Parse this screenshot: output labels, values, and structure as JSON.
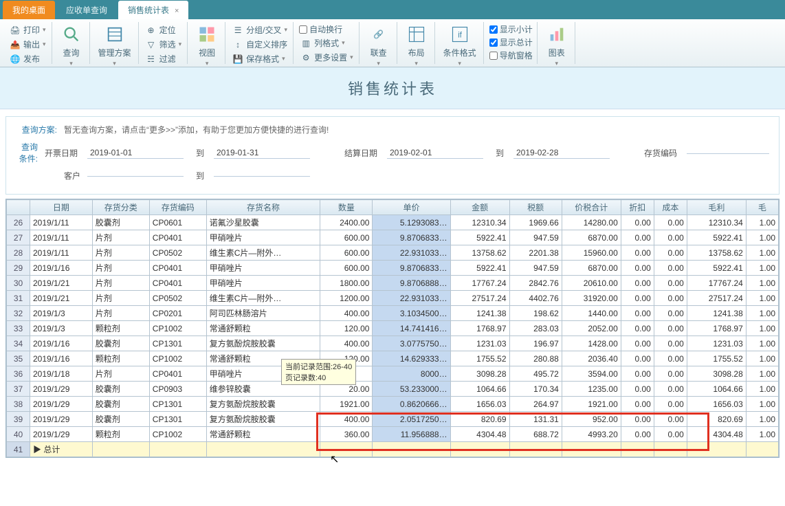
{
  "tabs": {
    "desktop": "我的桌面",
    "receivable": "应收单查询",
    "sales": "销售统计表"
  },
  "ribbon": {
    "print": "打印",
    "export": "输出",
    "publish": "发布",
    "search": "查询",
    "scheme": "管理方案",
    "locate": "定位",
    "filter": "筛选",
    "filter2": "过滤",
    "view": "视图",
    "group": "分组/交叉",
    "sort": "自定义排序",
    "savefmt": "保存格式",
    "autowrap": "自动换行",
    "colfmt": "列格式",
    "more": "更多设置",
    "link": "联查",
    "layout": "布局",
    "condfmt": "条件格式",
    "subtotal": "显示小计",
    "total": "显示总计",
    "nav": "导航窗格",
    "chart": "图表"
  },
  "title": "销售统计表",
  "query": {
    "scheme_label": "查询方案:",
    "scheme_text": "暂无查询方案，请点击“更多>>”添加，有助于您更加方便快捷的进行查询!",
    "cond_label": "查询条件:",
    "invoice_date": "开票日期",
    "to": "到",
    "settle_date": "结算日期",
    "inv_code": "存货编码",
    "customer": "客户",
    "d1": "2019-01-01",
    "d2": "2019-01-31",
    "d3": "2019-02-01",
    "d4": "2019-02-28"
  },
  "cols": {
    "date": "日期",
    "cat": "存货分类",
    "code": "存货编码",
    "name": "存货名称",
    "qty": "数量",
    "price": "单价",
    "amount": "金额",
    "tax": "税额",
    "pricetax": "价税合计",
    "discount": "折扣",
    "cost": "成本",
    "profit": "毛利",
    "rate": "毛"
  },
  "rows": [
    {
      "n": "26",
      "date": "2019/1/11",
      "cat": "胶囊剂",
      "code": "CP0601",
      "name": "诺氟沙星胶囊",
      "qty": "2400.00",
      "price": "5.1293083…",
      "amount": "12310.34",
      "tax": "1969.66",
      "pt": "14280.00",
      "disc": "0.00",
      "cost": "0.00",
      "profit": "12310.34",
      "r": "1.00"
    },
    {
      "n": "27",
      "date": "2019/1/11",
      "cat": "片剂",
      "code": "CP0401",
      "name": "甲硝唑片",
      "qty": "600.00",
      "price": "9.8706833…",
      "amount": "5922.41",
      "tax": "947.59",
      "pt": "6870.00",
      "disc": "0.00",
      "cost": "0.00",
      "profit": "5922.41",
      "r": "1.00"
    },
    {
      "n": "28",
      "date": "2019/1/11",
      "cat": "片剂",
      "code": "CP0502",
      "name": "维生素C片—附外…",
      "qty": "600.00",
      "price": "22.931033…",
      "amount": "13758.62",
      "tax": "2201.38",
      "pt": "15960.00",
      "disc": "0.00",
      "cost": "0.00",
      "profit": "13758.62",
      "r": "1.00"
    },
    {
      "n": "29",
      "date": "2019/1/16",
      "cat": "片剂",
      "code": "CP0401",
      "name": "甲硝唑片",
      "qty": "600.00",
      "price": "9.8706833…",
      "amount": "5922.41",
      "tax": "947.59",
      "pt": "6870.00",
      "disc": "0.00",
      "cost": "0.00",
      "profit": "5922.41",
      "r": "1.00"
    },
    {
      "n": "30",
      "date": "2019/1/21",
      "cat": "片剂",
      "code": "CP0401",
      "name": "甲硝唑片",
      "qty": "1800.00",
      "price": "9.8706888…",
      "amount": "17767.24",
      "tax": "2842.76",
      "pt": "20610.00",
      "disc": "0.00",
      "cost": "0.00",
      "profit": "17767.24",
      "r": "1.00"
    },
    {
      "n": "31",
      "date": "2019/1/21",
      "cat": "片剂",
      "code": "CP0502",
      "name": "维生素C片—附外…",
      "qty": "1200.00",
      "price": "22.931033…",
      "amount": "27517.24",
      "tax": "4402.76",
      "pt": "31920.00",
      "disc": "0.00",
      "cost": "0.00",
      "profit": "27517.24",
      "r": "1.00"
    },
    {
      "n": "32",
      "date": "2019/1/3",
      "cat": "片剂",
      "code": "CP0201",
      "name": "阿司匹林肠溶片",
      "qty": "400.00",
      "price": "3.1034500…",
      "amount": "1241.38",
      "tax": "198.62",
      "pt": "1440.00",
      "disc": "0.00",
      "cost": "0.00",
      "profit": "1241.38",
      "r": "1.00"
    },
    {
      "n": "33",
      "date": "2019/1/3",
      "cat": "颗粒剂",
      "code": "CP1002",
      "name": "常通舒颗粒",
      "qty": "120.00",
      "price": "14.741416…",
      "amount": "1768.97",
      "tax": "283.03",
      "pt": "2052.00",
      "disc": "0.00",
      "cost": "0.00",
      "profit": "1768.97",
      "r": "1.00"
    },
    {
      "n": "34",
      "date": "2019/1/16",
      "cat": "胶囊剂",
      "code": "CP1301",
      "name": "复方氨酚烷胺胶囊",
      "qty": "400.00",
      "price": "3.0775750…",
      "amount": "1231.03",
      "tax": "196.97",
      "pt": "1428.00",
      "disc": "0.00",
      "cost": "0.00",
      "profit": "1231.03",
      "r": "1.00"
    },
    {
      "n": "35",
      "date": "2019/1/16",
      "cat": "颗粒剂",
      "code": "CP1002",
      "name": "常通舒颗粒",
      "qty": "120.00",
      "price": "14.629333…",
      "amount": "1755.52",
      "tax": "280.88",
      "pt": "2036.40",
      "disc": "0.00",
      "cost": "0.00",
      "profit": "1755.52",
      "r": "1.00"
    },
    {
      "n": "36",
      "date": "2019/1/18",
      "cat": "片剂",
      "code": "CP0401",
      "name": "甲硝唑片",
      "qty": "",
      "price": "8000…",
      "amount": "3098.28",
      "tax": "495.72",
      "pt": "3594.00",
      "disc": "0.00",
      "cost": "0.00",
      "profit": "3098.28",
      "r": "1.00"
    },
    {
      "n": "37",
      "date": "2019/1/29",
      "cat": "胶囊剂",
      "code": "CP0903",
      "name": "维参锌胶囊",
      "qty": "20.00",
      "price": "53.233000…",
      "amount": "1064.66",
      "tax": "170.34",
      "pt": "1235.00",
      "disc": "0.00",
      "cost": "0.00",
      "profit": "1064.66",
      "r": "1.00"
    },
    {
      "n": "38",
      "date": "2019/1/29",
      "cat": "胶囊剂",
      "code": "CP1301",
      "name": "复方氨酚烷胺胶囊",
      "qty": "1921.00",
      "price": "0.8620666…",
      "amount": "1656.03",
      "tax": "264.97",
      "pt": "1921.00",
      "disc": "0.00",
      "cost": "0.00",
      "profit": "1656.03",
      "r": "1.00"
    },
    {
      "n": "39",
      "date": "2019/1/29",
      "cat": "胶囊剂",
      "code": "CP1301",
      "name": "复方氨酚烷胺胶囊",
      "qty": "400.00",
      "price": "2.0517250…",
      "amount": "820.69",
      "tax": "131.31",
      "pt": "952.00",
      "disc": "0.00",
      "cost": "0.00",
      "profit": "820.69",
      "r": "1.00"
    },
    {
      "n": "40",
      "date": "2019/1/29",
      "cat": "颗粒剂",
      "code": "CP1002",
      "name": "常通舒颗粒",
      "qty": "360.00",
      "price": "11.956888…",
      "amount": "4304.48",
      "tax": "688.72",
      "pt": "4993.20",
      "disc": "0.00",
      "cost": "0.00",
      "profit": "4304.48",
      "r": "1.00"
    }
  ],
  "total_label": "总计",
  "tooltip": {
    "l1": "当前记录范围:26-40",
    "l2": "页记录数:40"
  }
}
